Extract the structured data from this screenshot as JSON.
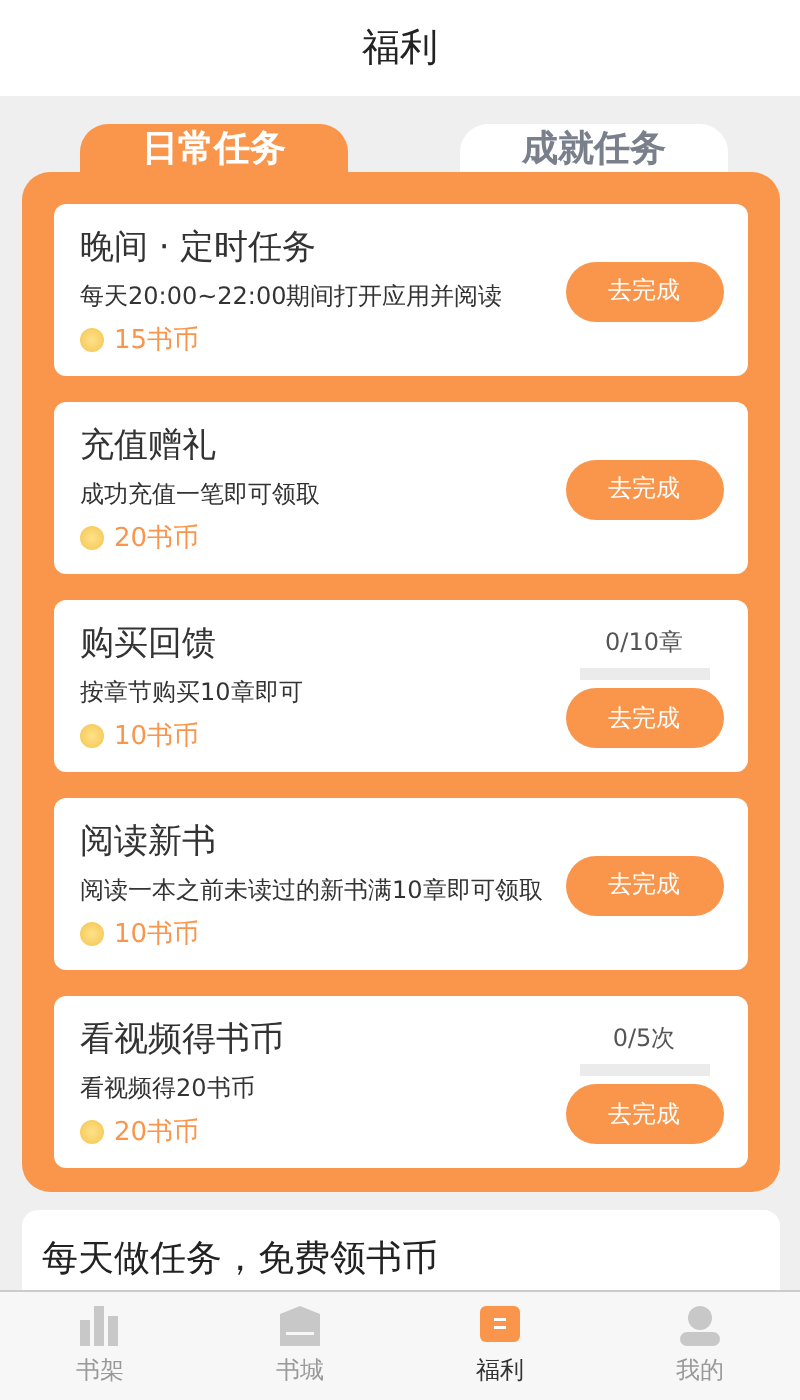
{
  "header": {
    "title": "福利"
  },
  "tabs": [
    {
      "label": "日常任务",
      "selected": true
    },
    {
      "label": "成就任务",
      "selected": false
    }
  ],
  "tasks": [
    {
      "title": "晚间 · 定时任务",
      "desc": "每天20:00~22:00期间打开应用并阅读",
      "reward": "15书币",
      "button": "去完成"
    },
    {
      "title": "充值赠礼",
      "desc": "成功充值一笔即可领取",
      "reward": "20书币",
      "button": "去完成"
    },
    {
      "title": "购买回馈",
      "desc": "按章节购买10章即可",
      "reward": "10书币",
      "button": "去完成",
      "progress": {
        "text": "0/10章",
        "level": 0
      }
    },
    {
      "title": "阅读新书",
      "desc": "阅读一本之前未读过的新书满10章即可领取",
      "reward": "10书币",
      "button": "去完成"
    },
    {
      "title": "看视频得书币",
      "desc": "看视频得20书币",
      "reward": "20书币",
      "button": "去完成",
      "progress": {
        "text": "0/5次",
        "level": 0
      }
    }
  ],
  "section": {
    "title": "每天做任务，免费领书币"
  },
  "nav": [
    {
      "label": "书架",
      "kind": "shelf",
      "selected": false
    },
    {
      "label": "书城",
      "kind": "store",
      "selected": false
    },
    {
      "label": "福利",
      "kind": "welfare",
      "selected": true
    },
    {
      "label": "我的",
      "kind": "me",
      "selected": false
    }
  ]
}
